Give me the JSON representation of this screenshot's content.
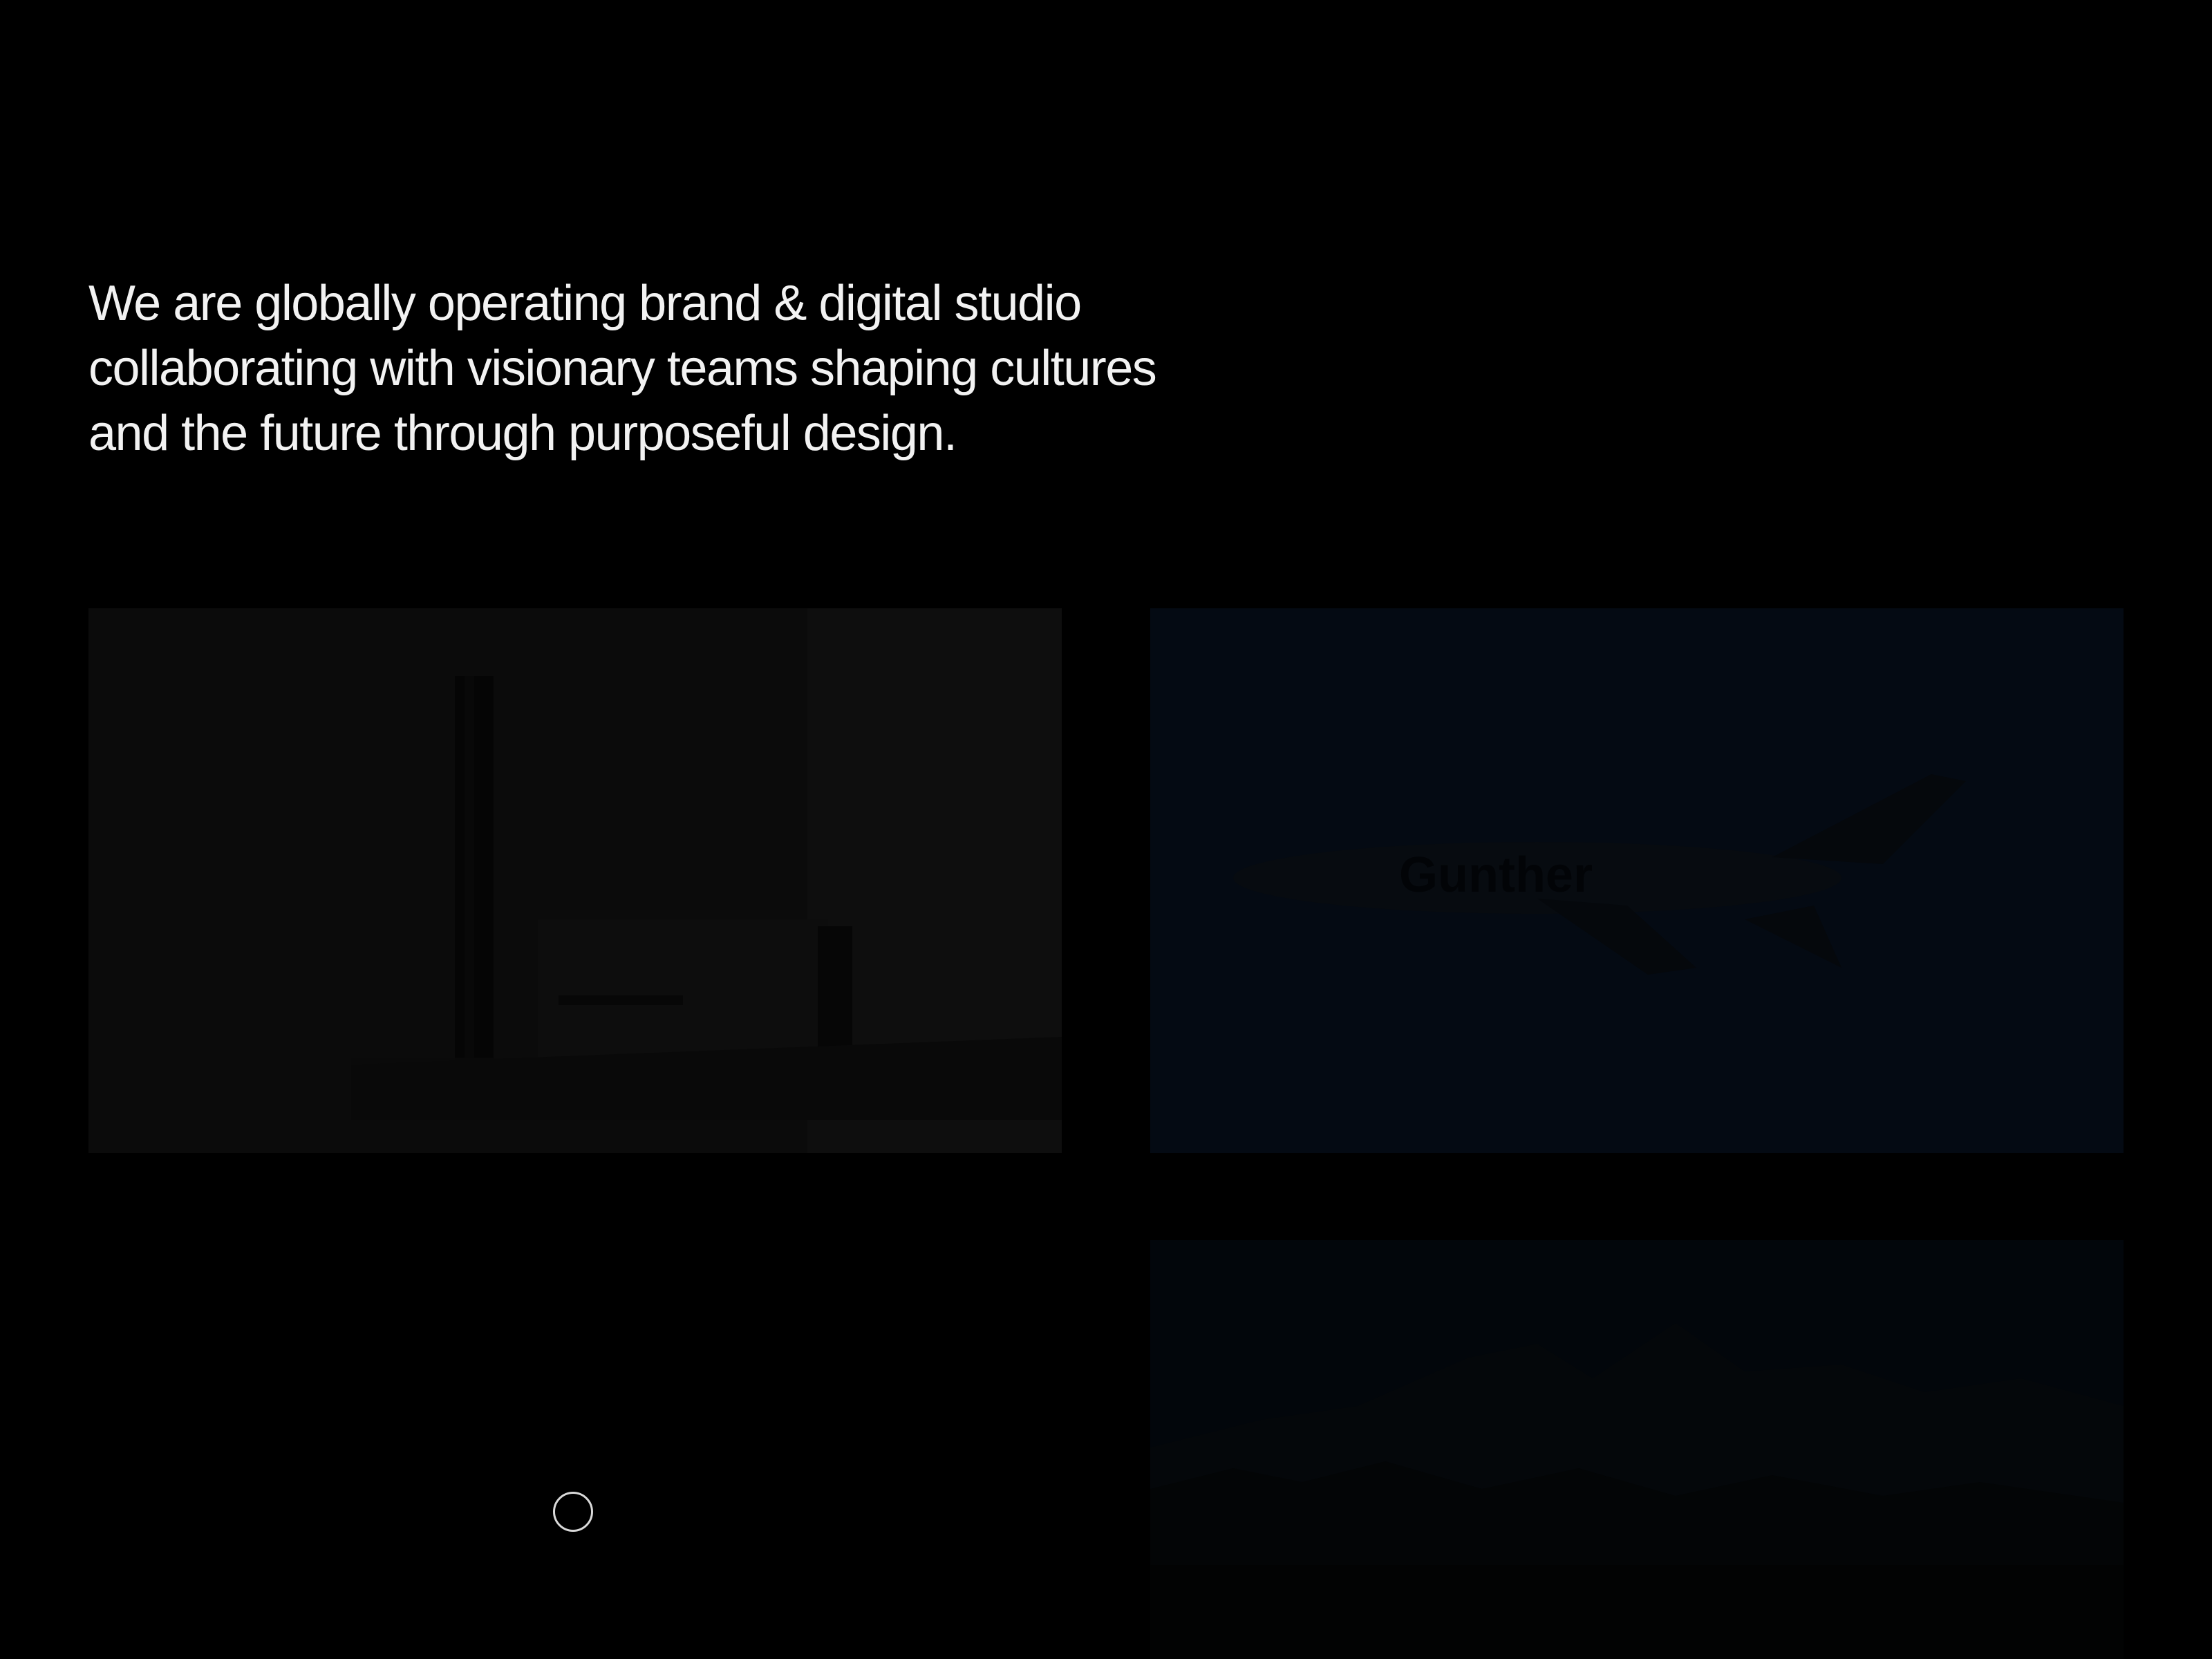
{
  "intro": {
    "lines": [
      "We are globally operating brand & digital studio",
      "collaborating with visionary teams shaping cultures",
      "and the future through purposeful design."
    ]
  },
  "projects": [
    {
      "name": "product-photo",
      "overlay_text": ""
    },
    {
      "name": "airplane-photo",
      "overlay_text": "Gunther"
    },
    {
      "name": "mountain-photo",
      "overlay_text": ""
    }
  ],
  "colors": {
    "background": "#000000",
    "text": "#f2f2f2",
    "loader": "#d9d9d9"
  },
  "icons": {
    "cursor": "circle-cursor-icon"
  }
}
